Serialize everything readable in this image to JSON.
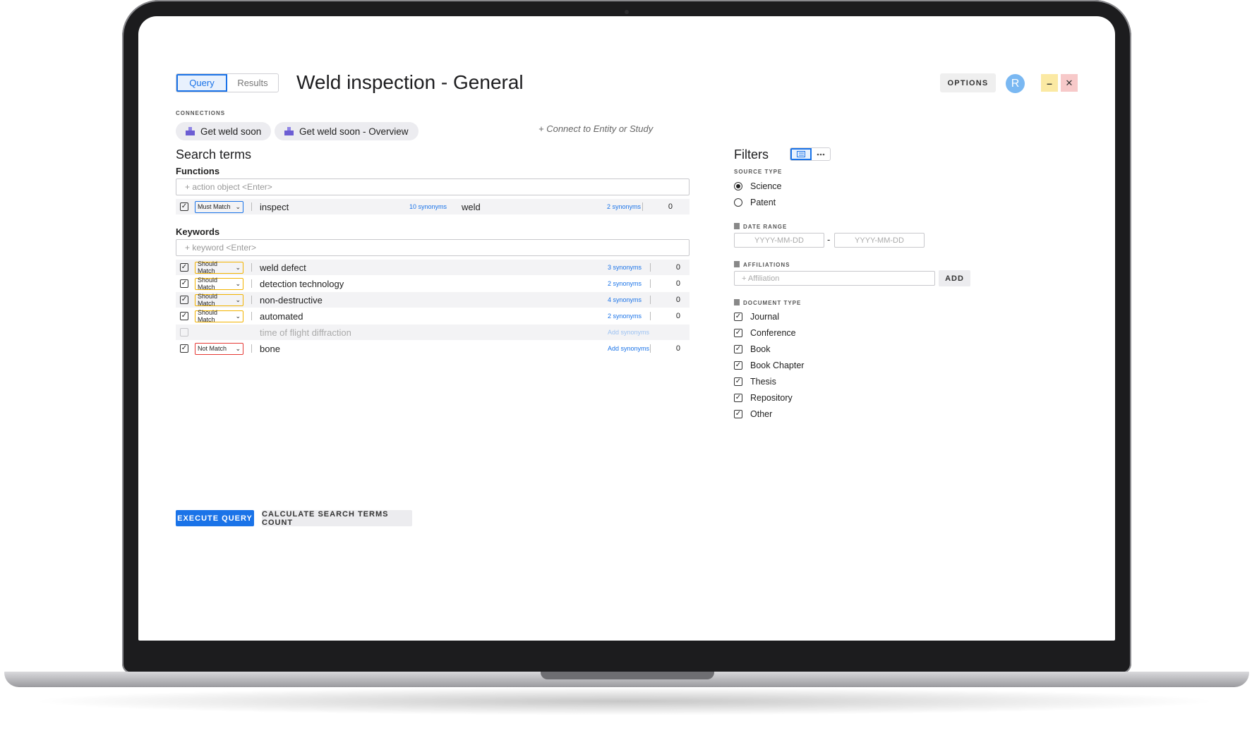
{
  "tabs": {
    "query": "Query",
    "results": "Results"
  },
  "title": "Weld inspection - General",
  "header": {
    "options": "OPTIONS",
    "avatar": "R",
    "minimize": "–",
    "close": "✕"
  },
  "connections": {
    "label": "CONNECTIONS",
    "chips": [
      "Get weld soon",
      "Get weld soon - Overview"
    ],
    "connect_link": "+ Connect to Entity or Study"
  },
  "search_terms": {
    "heading": "Search terms",
    "functions": {
      "label": "Functions",
      "placeholder": "+ action object <Enter>",
      "rows": [
        {
          "checked": true,
          "match": "Must Match",
          "term": "inspect",
          "synonyms": "10 synonyms",
          "term2": "weld",
          "synonyms2": "2 synonyms",
          "count": "0"
        }
      ]
    },
    "keywords": {
      "label": "Keywords",
      "placeholder": "+ keyword <Enter>",
      "rows": [
        {
          "checked": true,
          "match": "Should Match",
          "term": "weld defect",
          "synonyms": "3 synonyms",
          "count": "0"
        },
        {
          "checked": true,
          "match": "Should Match",
          "term": "detection technology",
          "synonyms": "2 synonyms",
          "count": "0"
        },
        {
          "checked": true,
          "match": "Should Match",
          "term": "non-destructive",
          "synonyms": "4 synonyms",
          "count": "0"
        },
        {
          "checked": true,
          "match": "Should Match",
          "term": "automated",
          "synonyms": "2 synonyms",
          "count": "0"
        },
        {
          "checked": false,
          "match": "",
          "term": "time of flight diffraction",
          "synonyms": "Add synonyms",
          "count": ""
        },
        {
          "checked": true,
          "match": "Not Match",
          "term": "bone",
          "synonyms": "Add synonyms",
          "count": "0"
        }
      ]
    }
  },
  "actions": {
    "execute": "EXECUTE QUERY",
    "calculate": "CALCULATE SEARCH TERMS COUNT"
  },
  "filters": {
    "heading": "Filters",
    "source_type": {
      "label": "SOURCE TYPE",
      "options": [
        "Science",
        "Patent"
      ],
      "selected": "Science"
    },
    "date_range": {
      "label": "DATE RANGE",
      "from_placeholder": "YYYY-MM-DD",
      "to_placeholder": "YYYY-MM-DD",
      "separator": "-"
    },
    "affiliations": {
      "label": "AFFILIATIONS",
      "placeholder": "+ Affiliation",
      "add": "ADD"
    },
    "document_type": {
      "label": "DOCUMENT TYPE",
      "options": [
        "Journal",
        "Conference",
        "Book",
        "Book Chapter",
        "Thesis",
        "Repository",
        "Other"
      ]
    }
  },
  "colors": {
    "accent": "#1a73e8",
    "should_match": "#f2b300",
    "not_match": "#e53935",
    "minimize_bg": "#fbe9a3",
    "close_bg": "#f7c9c9",
    "avatar_bg": "#7ab8f2"
  }
}
